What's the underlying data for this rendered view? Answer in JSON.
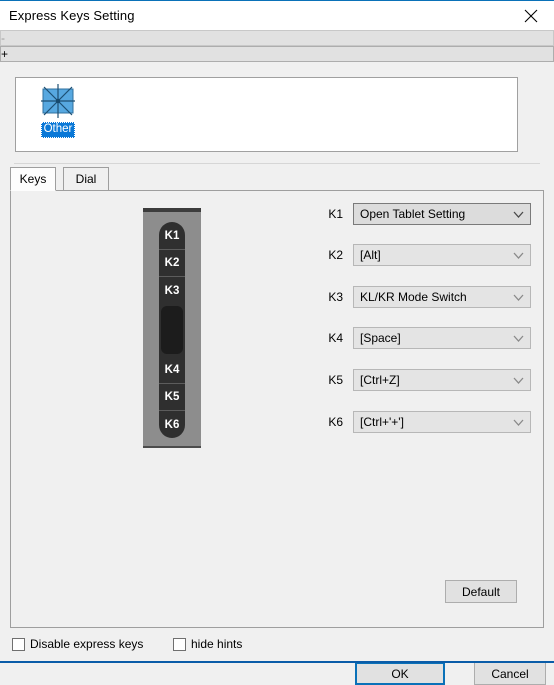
{
  "window": {
    "title": "Express Keys Setting",
    "close_icon": "close-icon"
  },
  "device_list": {
    "items": [
      {
        "icon": "tablet-starburst-icon",
        "label": "Other",
        "selected": true
      }
    ],
    "remove_button": "-",
    "add_button": "+"
  },
  "tabs": [
    {
      "id": "keys",
      "label": "Keys",
      "selected": true
    },
    {
      "id": "dial",
      "label": "Dial",
      "selected": false
    }
  ],
  "tablet_preview": {
    "keys": [
      "K1",
      "K2",
      "K3",
      "K4",
      "K5",
      "K6"
    ],
    "dial_element": "touch-strip"
  },
  "key_bindings": [
    {
      "key": "K1",
      "value": "Open Tablet Setting",
      "active": true
    },
    {
      "key": "K2",
      "value": "[Alt]",
      "active": false
    },
    {
      "key": "K3",
      "value": "KL/KR Mode Switch",
      "active": false
    },
    {
      "key": "K4",
      "value": "[Space]",
      "active": false
    },
    {
      "key": "K5",
      "value": "[Ctrl+Z]",
      "active": false
    },
    {
      "key": "K6",
      "value": "[Ctrl+'+']",
      "active": false
    }
  ],
  "buttons": {
    "default": "Default",
    "ok": "OK",
    "cancel": "Cancel"
  },
  "checkboxes": [
    {
      "id": "disable-express-keys",
      "label": "Disable express keys",
      "checked": false
    },
    {
      "id": "hide-hints",
      "label": "hide hints",
      "checked": false
    }
  ],
  "colors": {
    "accent": "#0a71b8",
    "selection": "#0a78d7",
    "window_bg": "#f0f0f0",
    "tablet_body": "#8d8d8d",
    "keystrip": "#2f2f2f"
  }
}
